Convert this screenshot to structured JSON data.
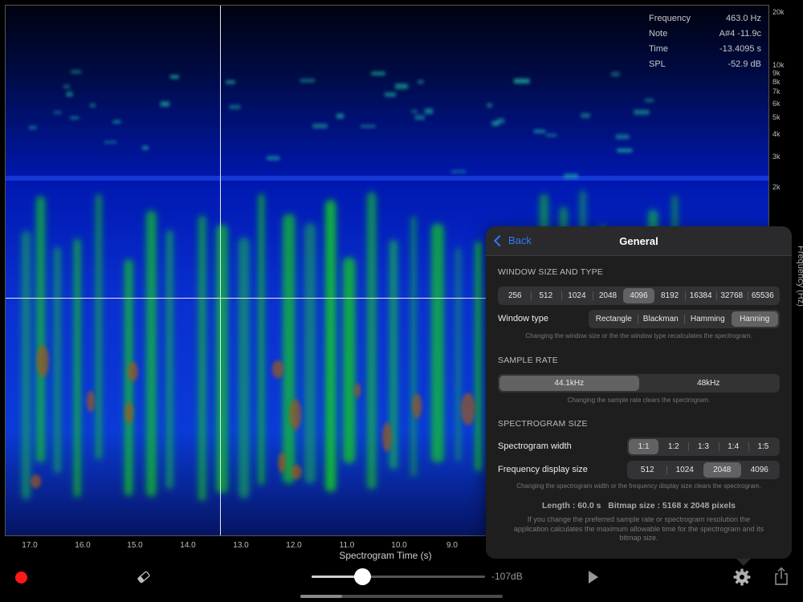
{
  "readout": [
    {
      "label": "Frequency",
      "value": "463.0 Hz"
    },
    {
      "label": "Note",
      "value": "A#4 -11.9c"
    },
    {
      "label": "Time",
      "value": "-13.4095 s"
    },
    {
      "label": "SPL",
      "value": "-52.9 dB"
    }
  ],
  "frequency_axis": {
    "label": "Frequency (Hz)",
    "ticks": [
      "20k",
      "10k",
      "9k",
      "8k",
      "7k",
      "6k",
      "5k",
      "4k",
      "3k",
      "2k"
    ]
  },
  "time_axis": {
    "label": "Spectrogram Time (s)",
    "ticks": [
      "17.0",
      "16.0",
      "15.0",
      "14.0",
      "13.0",
      "12.0",
      "11.0",
      "10.0",
      "9.0"
    ]
  },
  "colors": {
    "record": "#ff1818",
    "accent": "#2f7cf6",
    "spectro_low": "#0012a8",
    "spectro_mid": "#14d21e",
    "spectro_high": "#a05a1e"
  },
  "toolbar": {
    "db_label": "-107dB",
    "slider_level": 0.29,
    "icons": [
      "record-icon",
      "eraser-icon",
      "play-icon",
      "gear-icon",
      "share-icon"
    ]
  },
  "settings": {
    "back_label": "Back",
    "title": "General",
    "window_section": {
      "heading": "WINDOW SIZE AND TYPE",
      "sizes": [
        "256",
        "512",
        "1024",
        "2048",
        "4096",
        "8192",
        "16384",
        "32768",
        "65536"
      ],
      "selected_size": "4096",
      "type_label": "Window type",
      "types": [
        "Rectangle",
        "Blackman",
        "Hamming",
        "Hanning"
      ],
      "selected_type": "Hanning",
      "note": "Changing the window size or the the window type recalculates the spectrogram."
    },
    "sample_section": {
      "heading": "SAMPLE RATE",
      "rates": [
        "44.1kHz",
        "48kHz"
      ],
      "selected_rate": "44.1kHz",
      "note": "Changing the sample rate clears the spectrogram."
    },
    "size_section": {
      "heading": "SPECTROGRAM SIZE",
      "width_label": "Spectrogram width",
      "widths": [
        "1:1",
        "1:2",
        "1:3",
        "1:4",
        "1:5"
      ],
      "selected_width": "1:1",
      "freq_label": "Frequency display size",
      "freq_sizes": [
        "512",
        "1024",
        "2048",
        "4096"
      ],
      "selected_freq": "2048",
      "note": "Changing the spectrogram width or the frequency display size clears the spectrogram."
    },
    "summary": {
      "length_label": "Length : 60.0 s",
      "bitmap_label": "Bitmap size : 5168 x 2048 pixels",
      "note": "If you change the preferred sample rate or spectrogram resolution the application calculates the maximum allowable time for the spectrogram and its bitmap size."
    }
  }
}
